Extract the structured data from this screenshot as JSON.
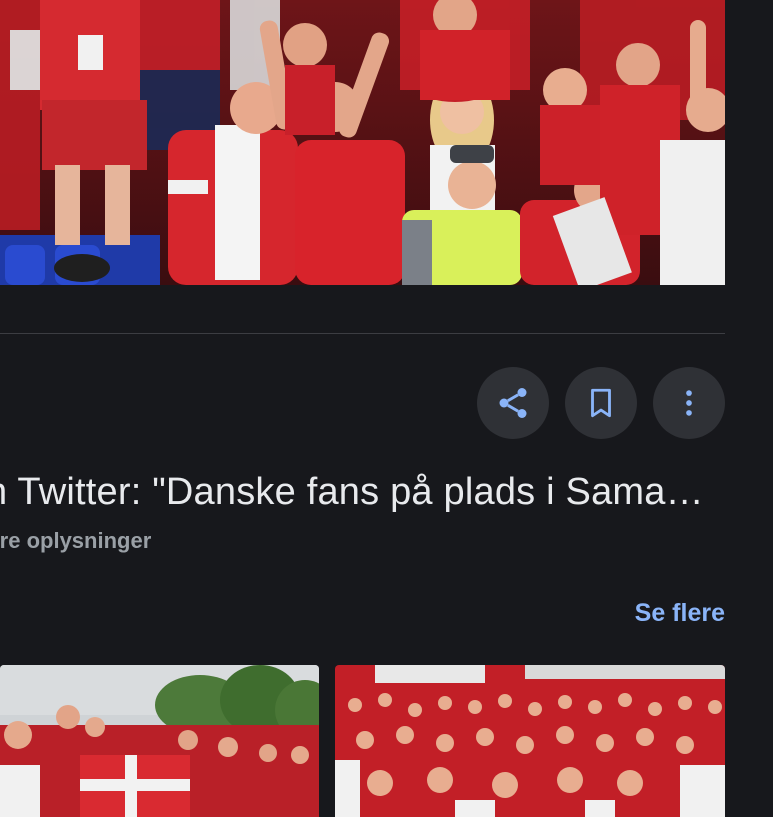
{
  "image_result": {
    "title": "n Twitter: \"Danske fans på plads i Sama…",
    "subtitle": "flere oplysninger",
    "actions": {
      "share_icon": "share-icon",
      "save_icon": "bookmark-icon",
      "more_icon": "more-vert-icon"
    }
  },
  "related": {
    "see_more_label": "Se flere"
  },
  "colors": {
    "background": "#17181c",
    "button_bg": "#2f3136",
    "accent_blue": "#8ab4f8",
    "title_text": "#e8eaed",
    "subtitle_text": "#9aa0a6",
    "divider": "#3c3d42",
    "denmark_red": "#c8102e"
  }
}
